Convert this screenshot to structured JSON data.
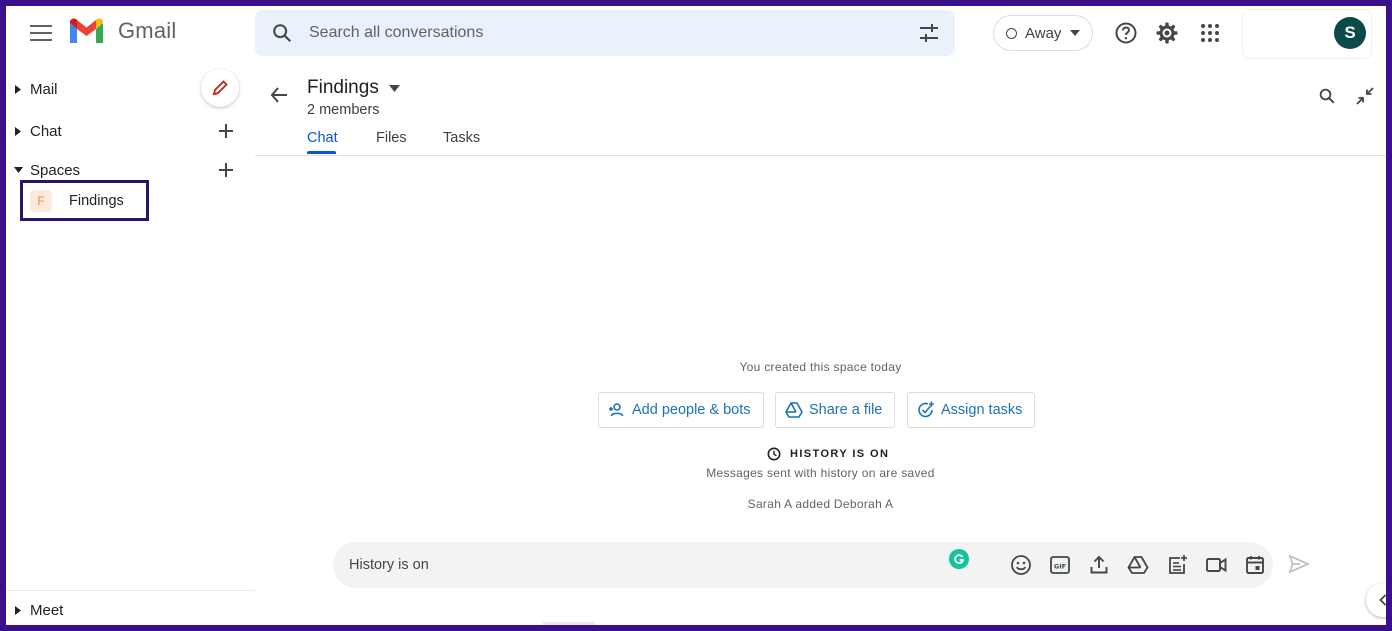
{
  "header": {
    "app_name": "Gmail",
    "search_placeholder": "Search all conversations",
    "status_label": "Away",
    "avatar_initial": "S"
  },
  "sidebar": {
    "mail_label": "Mail",
    "chat_label": "Chat",
    "spaces_label": "Spaces",
    "space_item": {
      "badge": "F",
      "label": "Findings"
    },
    "meet_label": "Meet"
  },
  "space": {
    "title": "Findings",
    "members": "2 members",
    "tabs": [
      {
        "label": "Chat",
        "active": true
      },
      {
        "label": "Files",
        "active": false
      },
      {
        "label": "Tasks",
        "active": false
      }
    ]
  },
  "conversation": {
    "created_text": "You created this space today",
    "actions": [
      {
        "label": "Add people & bots",
        "icon": "add-person-icon"
      },
      {
        "label": "Share a file",
        "icon": "drive-icon"
      },
      {
        "label": "Assign tasks",
        "icon": "add-task-icon"
      }
    ],
    "history_label": "HISTORY IS ON",
    "history_note": "Messages sent with history on are saved",
    "added_note": "Sarah A added Deborah A"
  },
  "composer": {
    "placeholder": "History is on",
    "icons": [
      "emoji-icon",
      "gif-icon",
      "upload-icon",
      "drive-icon",
      "add-note-icon",
      "video-call-icon",
      "calendar-icon"
    ]
  },
  "colors": {
    "accent": "#0b57d0",
    "highlight_border": "#2b1466",
    "page_border": "#3a0f8a",
    "avatar_bg": "#0b4a48"
  }
}
